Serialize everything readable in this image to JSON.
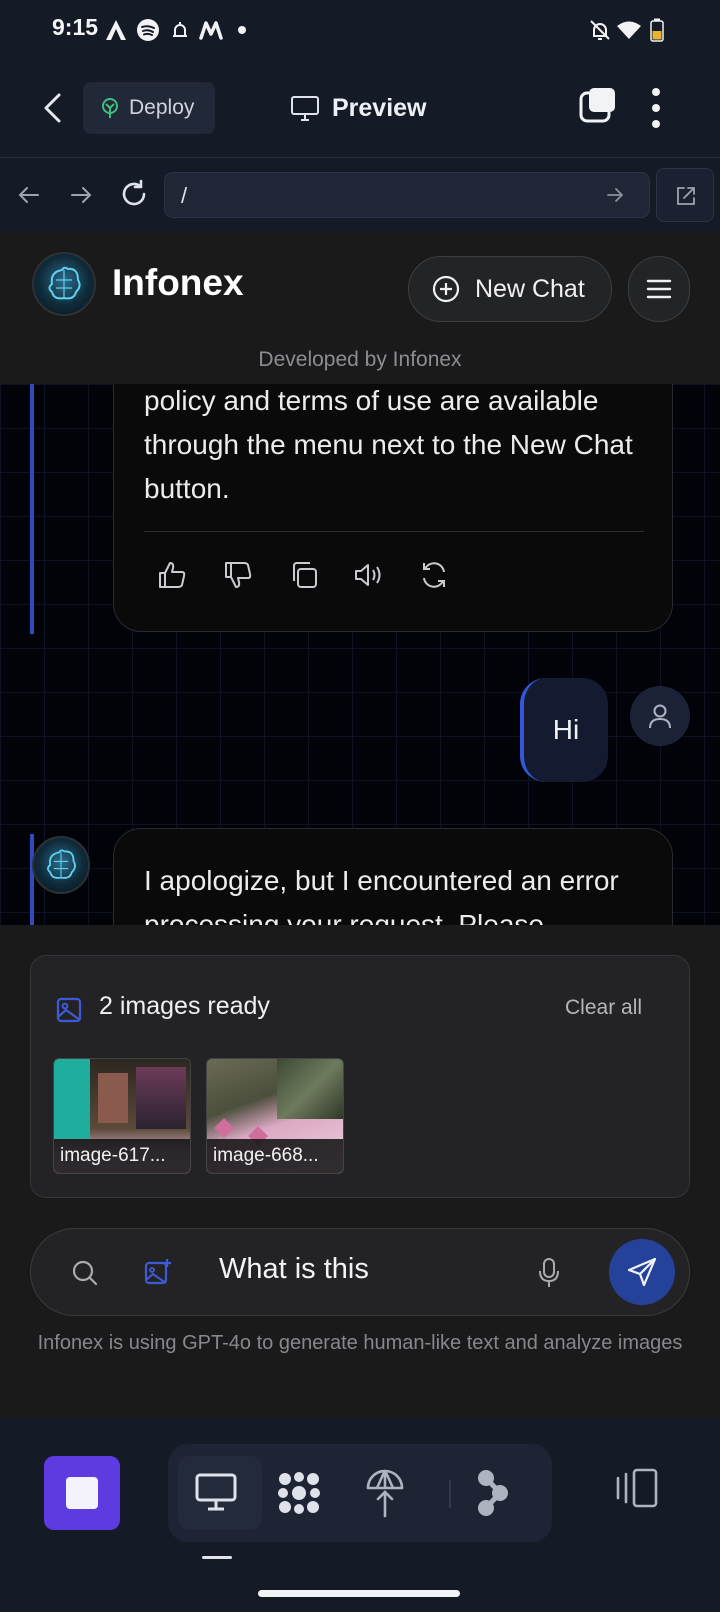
{
  "status_bar": {
    "time": "9:15",
    "icons": [
      "a-app-icon",
      "spotify-icon",
      "bell-icon",
      "m-app-icon",
      "dot-icon",
      "notifications-off-icon",
      "wifi-icon",
      "battery-icon"
    ]
  },
  "app_bar": {
    "deploy_label": "Deploy",
    "preview_label": "Preview"
  },
  "url_bar": {
    "url": "/"
  },
  "site_header": {
    "brand_name": "Infonex",
    "new_chat_label": "New Chat",
    "developed_by": "Developed by Infonex"
  },
  "chat": {
    "ai_message_1": "policy and terms of use are available through the menu next to the New Chat button.",
    "user_message": "Hi",
    "ai_message_2": "I apologize, but I encountered an error processing your request. Please"
  },
  "attachments": {
    "header": "2 images ready",
    "clear_label": "Clear all",
    "images": [
      {
        "label": "image-617..."
      },
      {
        "label": "image-668..."
      }
    ]
  },
  "composer": {
    "text": "What is this"
  },
  "disclaimer": "Infonex is using GPT-4o to generate human-like text and analyze images",
  "colors": {
    "accent_blue": "#25429a",
    "stop_purple": "#5e3be0",
    "user_bubble": "#141b31"
  }
}
